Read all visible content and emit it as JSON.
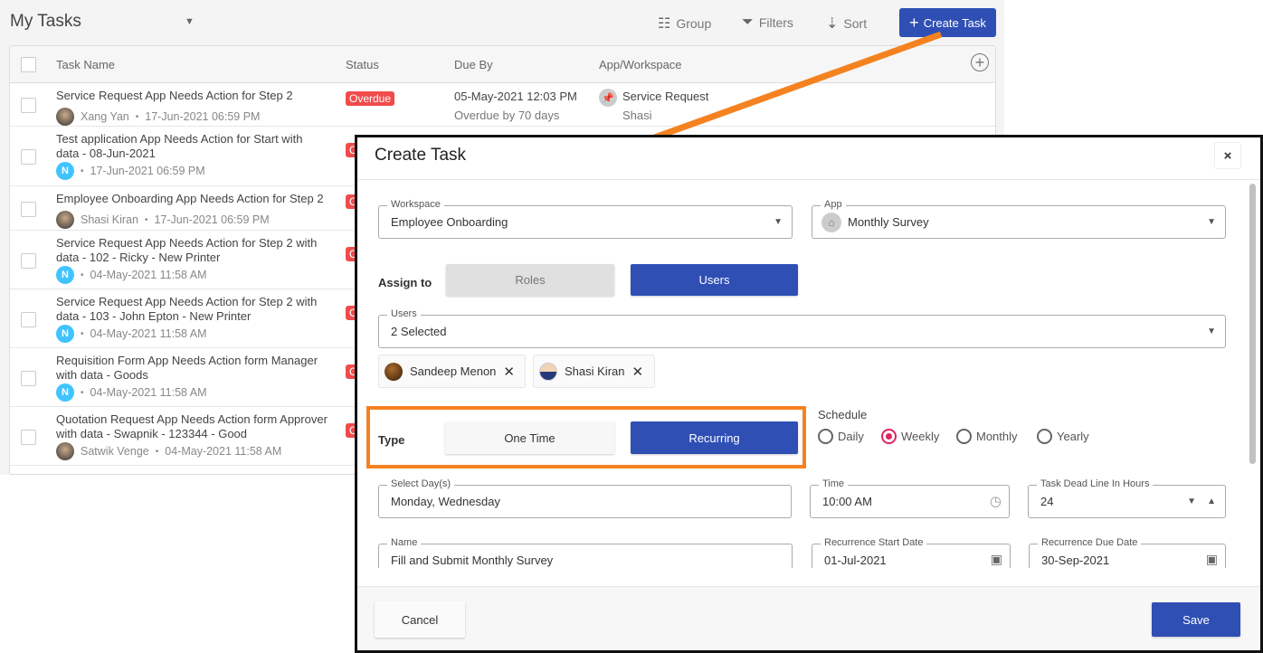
{
  "header": {
    "title": "My Tasks",
    "group": "Group",
    "filters": "Filters",
    "sort": "Sort",
    "create": "Create Task"
  },
  "table": {
    "columns": [
      "Task Name",
      "Status",
      "Due By",
      "App/Workspace"
    ],
    "rows": [
      {
        "name": "Service Request App Needs Action for Step 2",
        "user": "Xang Yan",
        "avatar": "photo",
        "date": "17-Jun-2021 06:59 PM",
        "status": "Overdue",
        "due": "05-May-2021 12:03 PM",
        "due_note": "Overdue by 70 days",
        "app": "Service Request",
        "workspace": "Shasi"
      },
      {
        "name": "Test application App Needs Action for Start with data - 08-Jun-2021",
        "user": "",
        "avatar": "N",
        "date": "17-Jun-2021 06:59 PM",
        "status": "O"
      },
      {
        "name": "Employee Onboarding App Needs Action for Step 2",
        "user": "Shasi Kiran",
        "avatar": "photo",
        "date": "17-Jun-2021 06:59 PM",
        "status": "O"
      },
      {
        "name": "Service Request App Needs Action for Step 2 with data - 102 - Ricky - New Printer",
        "user": "",
        "avatar": "N",
        "date": "04-May-2021 11:58 AM",
        "status": "O"
      },
      {
        "name": "Service Request App Needs Action for Step 2 with data - 103 - John Epton - New Printer",
        "user": "",
        "avatar": "N",
        "date": "04-May-2021 11:58 AM",
        "status": "O"
      },
      {
        "name": "Requisition Form App Needs Action form Manager with data - Goods",
        "user": "",
        "avatar": "N",
        "date": "04-May-2021 11:58 AM",
        "status": "O"
      },
      {
        "name": "Quotation Request App Needs Action form Approver with data - Swapnik - 123344 - Good",
        "user": "Satwik Venge",
        "avatar": "photo",
        "date": "04-May-2021 11:58 AM",
        "status": "O"
      }
    ]
  },
  "modal": {
    "title": "Create Task",
    "close": "×",
    "workspace": {
      "label": "Workspace",
      "value": "Employee Onboarding"
    },
    "app": {
      "label": "App",
      "value": "Monthly Survey"
    },
    "assign_label": "Assign to",
    "roles": "Roles",
    "users_btn": "Users",
    "users": {
      "label": "Users",
      "value": "2 Selected"
    },
    "chips": [
      "Sandeep Menon",
      "Shasi Kiran"
    ],
    "type_label": "Type",
    "one_time": "One Time",
    "recurring": "Recurring",
    "schedule_label": "Schedule",
    "schedule_options": [
      "Daily",
      "Weekly",
      "Monthly",
      "Yearly"
    ],
    "schedule_selected": "Weekly",
    "days": {
      "label": "Select Day(s)",
      "value": "Monday, Wednesday"
    },
    "time": {
      "label": "Time",
      "value": "10:00 AM"
    },
    "deadline": {
      "label": "Task Dead Line In Hours",
      "value": "24"
    },
    "name": {
      "label": "Name",
      "value": "Fill and Submit Monthly Survey"
    },
    "start": {
      "label": "Recurrence Start Date",
      "value": "01-Jul-2021"
    },
    "due": {
      "label": "Recurrence Due Date",
      "value": "30-Sep-2021"
    },
    "cancel": "Cancel",
    "save": "Save"
  },
  "colors": {
    "primary": "#2f4fb5",
    "overdue": "#f14b4b",
    "highlight": "#f58220",
    "radio": "#e0245e",
    "avatar_n": "#40c4ff"
  }
}
